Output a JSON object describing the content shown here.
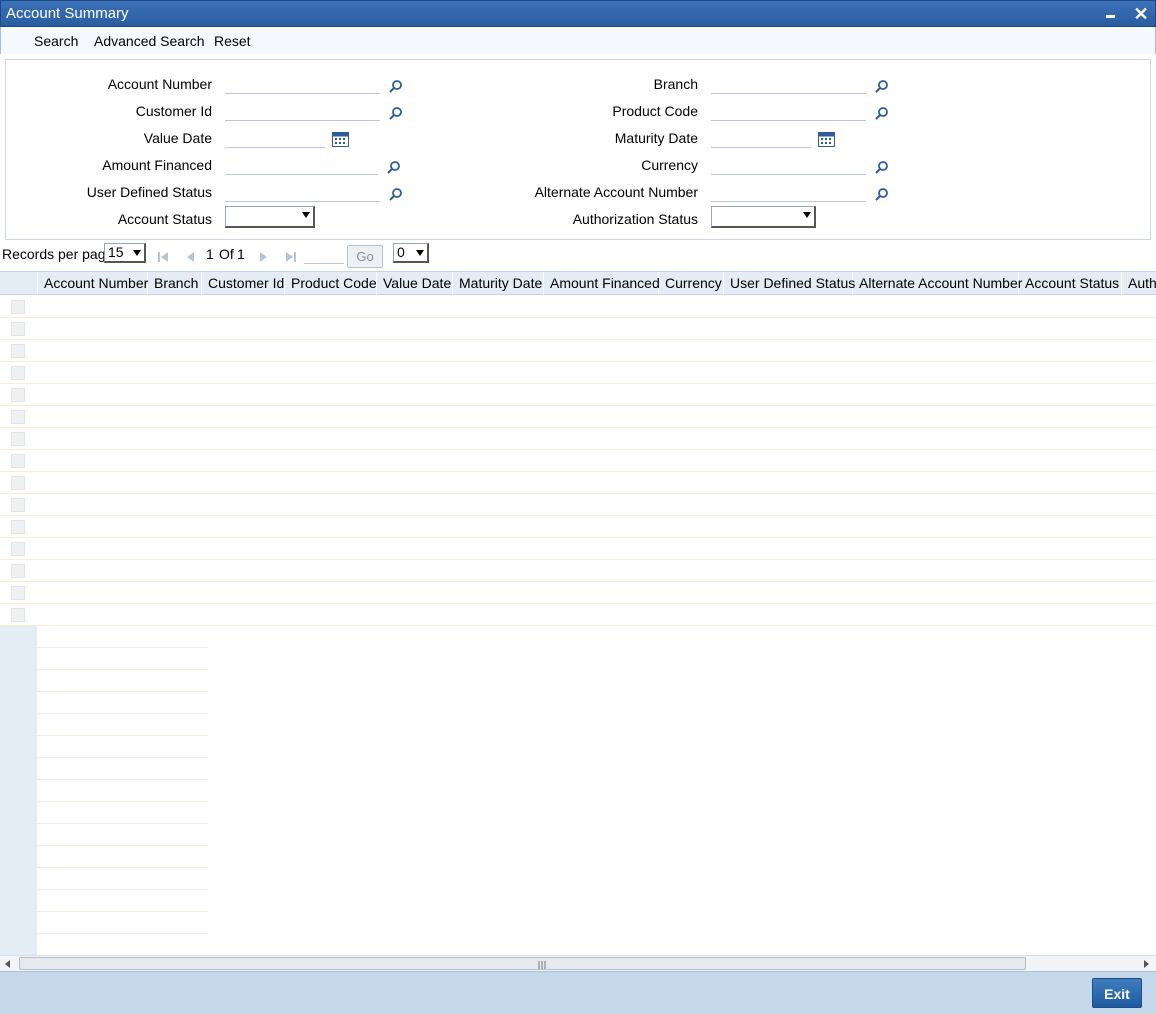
{
  "window": {
    "title": "Account Summary"
  },
  "menu": {
    "search": "Search",
    "advanced_search": "Advanced Search",
    "reset": "Reset"
  },
  "criteria": {
    "account_number": "Account Number",
    "customer_id": "Customer Id",
    "value_date": "Value Date",
    "amount_financed": "Amount Financed",
    "user_defined_status": "User Defined Status",
    "account_status": "Account Status",
    "branch": "Branch",
    "product_code": "Product Code",
    "maturity_date": "Maturity Date",
    "currency": "Currency",
    "alternate_account_number": "Alternate Account Number",
    "authorization_status": "Authorization Status"
  },
  "pager": {
    "records_per_page_label": "Records per page",
    "records_per_page_value": "15",
    "current_page": "1",
    "of_label": "Of",
    "total_pages": "1",
    "go_label": "Go",
    "extra_select_value": "0"
  },
  "grid": {
    "columns": [
      "Account Number",
      "Branch",
      "Customer Id",
      "Product Code",
      "Value Date",
      "Maturity Date",
      "Amount Financed",
      "Currency",
      "User Defined Status",
      "Alternate Account Number",
      "Account Status",
      "Authorization Status"
    ]
  },
  "footer": {
    "exit_label": "Exit"
  },
  "colors": {
    "title_bar": "#2a5ca0",
    "header_bg": "#e4ecf6",
    "footer_bg": "#c4d8ea",
    "exit_button": "#1f5b9e"
  }
}
